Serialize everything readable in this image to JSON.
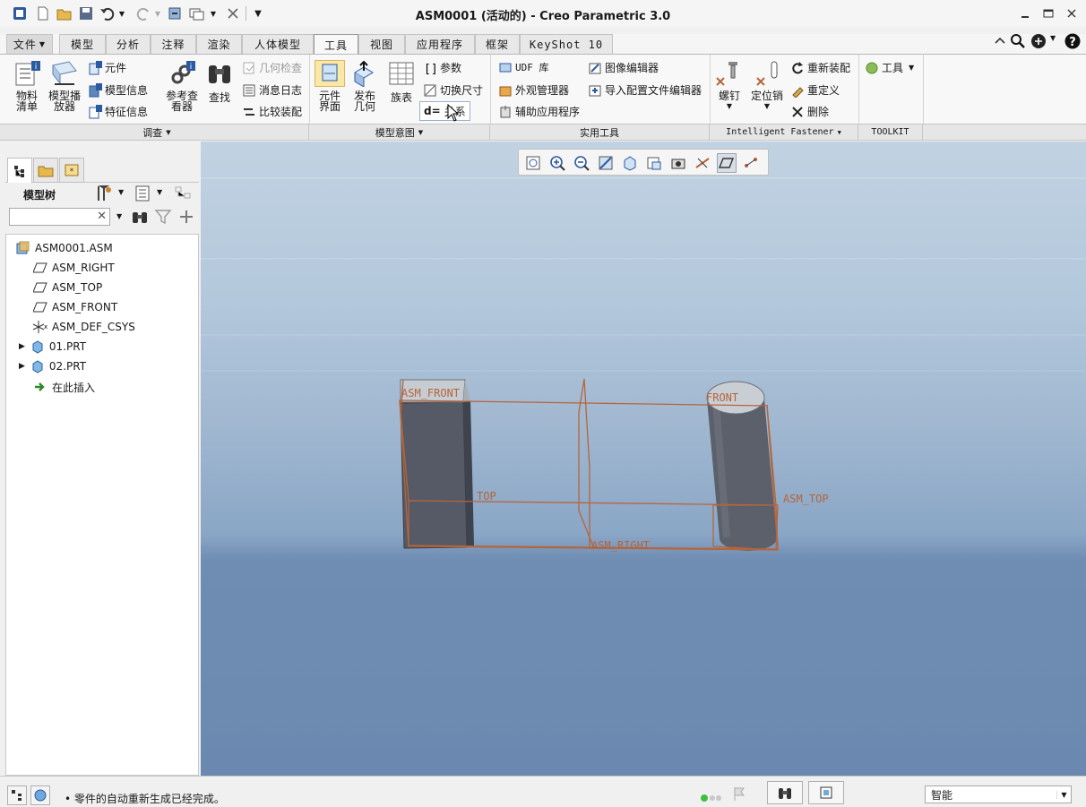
{
  "window": {
    "title": "ASM0001 (活动的) - Creo Parametric 3.0"
  },
  "quick_access": {
    "icons": [
      "new-icon",
      "open-icon",
      "save-icon",
      "undo-icon",
      "redo-icon",
      "regenerate-icon",
      "windows-icon",
      "close-window-icon",
      "customize-icon"
    ]
  },
  "tabs": [
    {
      "label": "文件"
    },
    {
      "label": "模型"
    },
    {
      "label": "分析"
    },
    {
      "label": "注释"
    },
    {
      "label": "渲染"
    },
    {
      "label": "人体模型"
    },
    {
      "label": "工具"
    },
    {
      "label": "视图"
    },
    {
      "label": "应用程序"
    },
    {
      "label": "框架"
    },
    {
      "label": "KeyShot 10"
    }
  ],
  "active_tab": "工具",
  "ribbon": {
    "investigate": {
      "bom": "物料\n清单",
      "model_player": "模型播\n放器",
      "component": "元件",
      "model_info": "模型信息",
      "feature_info": "特征信息",
      "ref_viewer": "参考查\n看器",
      "find": "查找",
      "geom_check": "几何检查",
      "message_log": "消息日志",
      "compare_assembly": "比较装配"
    },
    "model_intent": {
      "component_interface": "元件\n界面",
      "publish_geometry": "发布\n几何",
      "family_table": "族表",
      "parameters": "参数",
      "switch_dims": "切换尺寸",
      "relations": "关系"
    },
    "utilities": {
      "udf_library": "UDF 库",
      "appearance_manager": "外观管理器",
      "auxiliary_apps": "辅助应用程序",
      "image_editor": "图像编辑器",
      "import_config_editor": "导入配置文件编辑器"
    },
    "intelligent_fastener": {
      "screw": "螺钉",
      "dowel": "定位销",
      "reassemble": "重新装配",
      "redefine": "重定义",
      "delete": "删除"
    },
    "toolkit": {
      "tools": "工具"
    }
  },
  "groups": {
    "investigate": "调查",
    "model_intent": "模型意图",
    "utilities": "实用工具",
    "intelligent_fastener": "Intelligent Fastener",
    "toolkit": "TOOLKIT"
  },
  "left_panel": {
    "title": "模型树",
    "search_placeholder": "",
    "tree": [
      {
        "label": "ASM0001.ASM"
      },
      {
        "label": "ASM_RIGHT"
      },
      {
        "label": "ASM_TOP"
      },
      {
        "label": "ASM_FRONT"
      },
      {
        "label": "ASM_DEF_CSYS"
      },
      {
        "label": "01.PRT"
      },
      {
        "label": "02.PRT"
      },
      {
        "label": "在此插入"
      }
    ]
  },
  "viewport": {
    "labels": {
      "asm_front_left": "ASM_FRONT",
      "top_left": "TOP",
      "front_right": "FRONT",
      "asm_top_right": "ASM_TOP",
      "asm_right": "ASM_RIGHT"
    }
  },
  "status": {
    "message": "零件的自动重新生成已经完成。",
    "filter": "智能"
  },
  "colors": {
    "datum": "#b5653a",
    "part": "#4f5460",
    "accent_blue": "#2f7cc9"
  }
}
